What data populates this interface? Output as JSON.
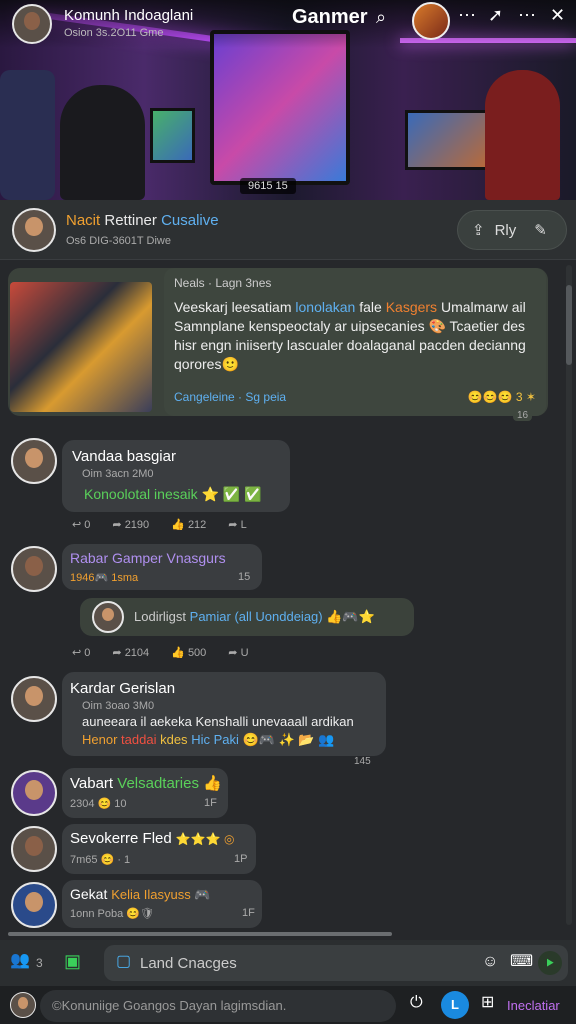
{
  "header": {
    "group_title": "Komunh Indoaglani",
    "group_sub": "Osion 3s.2O11 Gme",
    "brand": "Ganmer",
    "icons": [
      "search-icon",
      "more-icon",
      "share-icon",
      "more-icon",
      "close-icon"
    ]
  },
  "hero": {
    "caption": "9615 15"
  },
  "pinned": {
    "name_part1": "Nacit",
    "name_part2": "Rettiner",
    "name_part3": "Cusalive",
    "sub": "Os6 DIG-3601T Diwe",
    "reply_label": "Rly"
  },
  "post": {
    "head": "Neals · Lagn 3nes",
    "line1a": "Veeskarj leesatiam ",
    "line1b": "lonolakan",
    "line1c": " fale ",
    "line1d": "Kasgers",
    "line1e": " Umalmarw ail",
    "line2": "Samnplane kenspeoctaly ar uipsecanies 🎨 Tcaetier des",
    "line3": "hisr engn iniiserty lascualer doalaganal pacden decianng",
    "line4": "qorores🙂",
    "link": "Cangeleine · Sg peia",
    "reactions": "😊😊😊 3 ✶",
    "time": "16"
  },
  "messages": [
    {
      "name": "Vandaa basgiar",
      "sub": "Oim 3acn 2M0",
      "text": "Konoolotal inesaik ⭐ ✅ ✅",
      "actions": [
        "0",
        "2190",
        "212",
        "L"
      ]
    },
    {
      "name": "Rabar Gamper Vnasgurs",
      "sub": "1946🎮 1sma",
      "badge": "15"
    },
    {
      "reply_text": "Lodirligst",
      "reply_text2": "Pamiar (all Uonddeiag)",
      "reply_emoji": "👍🎮⭐",
      "actions": [
        "0",
        "2104",
        "500",
        "U"
      ]
    },
    {
      "name": "Kardar Gerislan",
      "sub": "Oim 3oao 3M0",
      "line1": "auneeara il aekeka Kenshalli unevaaall ardikan",
      "line2a": "Henor",
      "line2b": "taddai",
      "line2c": "kdes",
      "line2d": "Hic Paki",
      "line2e": "😊🎮 ✨ 📂 👥",
      "time": "145"
    },
    {
      "name": "Vabart",
      "name2": "Velsadtaries",
      "emoji": "👍",
      "sub": "2304 😊 10",
      "badge": "1F"
    },
    {
      "name": "Sevokerre Fled",
      "emoji": "⭐⭐⭐ ◎",
      "sub": "7m65 😊 · 1",
      "badge": "1P"
    },
    {
      "name": "Gekat",
      "name2": "Kelia Ilasyuss 🎮",
      "sub": "1onn Poba 😊🛡",
      "badge": "1F"
    }
  ],
  "composer": {
    "placeholder": "Land Cnacges",
    "count": "3"
  },
  "bottom": {
    "search_placeholder": "©Konuniige Goangos Dayan lagimsdian.",
    "online_label": "L",
    "insta_label": "Ineclatiar"
  }
}
